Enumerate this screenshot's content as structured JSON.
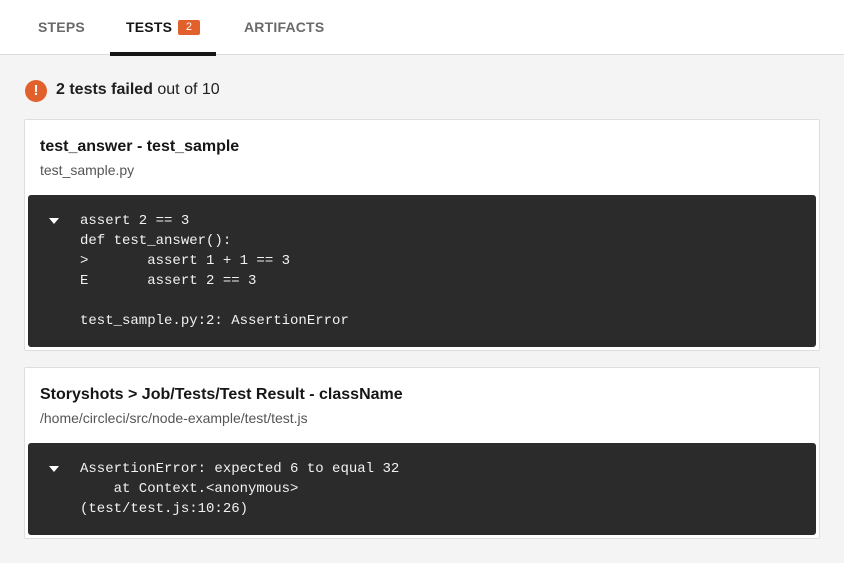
{
  "tabs": [
    {
      "label": "STEPS"
    },
    {
      "label": "TESTS",
      "badge": "2",
      "active": true
    },
    {
      "label": "ARTIFACTS"
    }
  ],
  "summary": {
    "icon": "error-icon",
    "icon_glyph": "!",
    "failed_text": "2 tests failed",
    "rest_text": " out of 10"
  },
  "failures": [
    {
      "title": "test_answer - test_sample",
      "file": "test_sample.py",
      "lines": [
        "assert 2 == 3",
        "def test_answer():",
        ">       assert 1 + 1 == 3",
        "E       assert 2 == 3",
        "",
        "test_sample.py:2: AssertionError"
      ]
    },
    {
      "title": "Storyshots > Job/Tests/Test Result - className",
      "file": "/home/circleci/src/node-example/test/test.js",
      "lines": [
        "AssertionError: expected 6 to equal 32",
        "    at Context.<anonymous>",
        "(test/test.js:10:26)"
      ]
    }
  ],
  "colors": {
    "accent": "#e1602b",
    "code_bg": "#2b2b2b",
    "active_tab": "#161616"
  }
}
